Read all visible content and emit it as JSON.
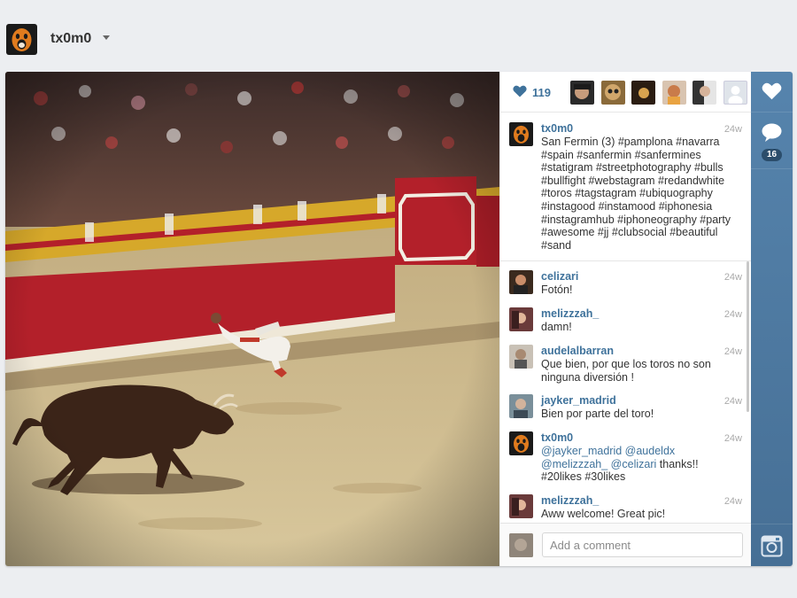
{
  "header": {
    "username": "tx0m0"
  },
  "post": {
    "likes_count": "119",
    "likers": [
      "liker-1",
      "liker-2",
      "liker-3",
      "liker-4",
      "liker-5",
      "liker-6"
    ],
    "caption": {
      "user": "tx0m0",
      "time": "24w",
      "text": "San Fermin (3) #pamplona #navarra #spain #sanfermin #sanfermines #statigram #streetphotography #bulls #bullfight #webstagram #redandwhite #toros #tagstagram #ubiquography #instagood #instamood #iphonesia #instagramhub #iphoneography #party #awesome #jj #clubsocial #beautiful #sand"
    },
    "comments": [
      {
        "user": "celizari",
        "time": "24w",
        "text": "Fotón!"
      },
      {
        "user": "melizzzah_",
        "time": "24w",
        "text": "damn!"
      },
      {
        "user": "audelalbarran",
        "time": "24w",
        "text": "Que bien, por que los toros no son ninguna diversión !"
      },
      {
        "user": "jayker_madrid",
        "time": "24w",
        "text": "Bien por parte del toro!"
      },
      {
        "user": "tx0m0",
        "time": "24w",
        "mentions": "@jayker_madrid @audeldx @melizzzah_ @celizari",
        "text": "thanks!! #20likes #30likes"
      },
      {
        "user": "melizzzah_",
        "time": "24w",
        "text": "Aww welcome! Great pic!"
      }
    ],
    "add_comment_placeholder": "Add a comment"
  },
  "sidebar": {
    "comment_count": "16",
    "icons": [
      "heart-icon",
      "comment-icon",
      "instagram-icon"
    ]
  },
  "colors": {
    "link": "#3f729b",
    "sidebar": "#4f7fa8",
    "arena_red": "#b3202a",
    "sand": "#cdb889"
  }
}
